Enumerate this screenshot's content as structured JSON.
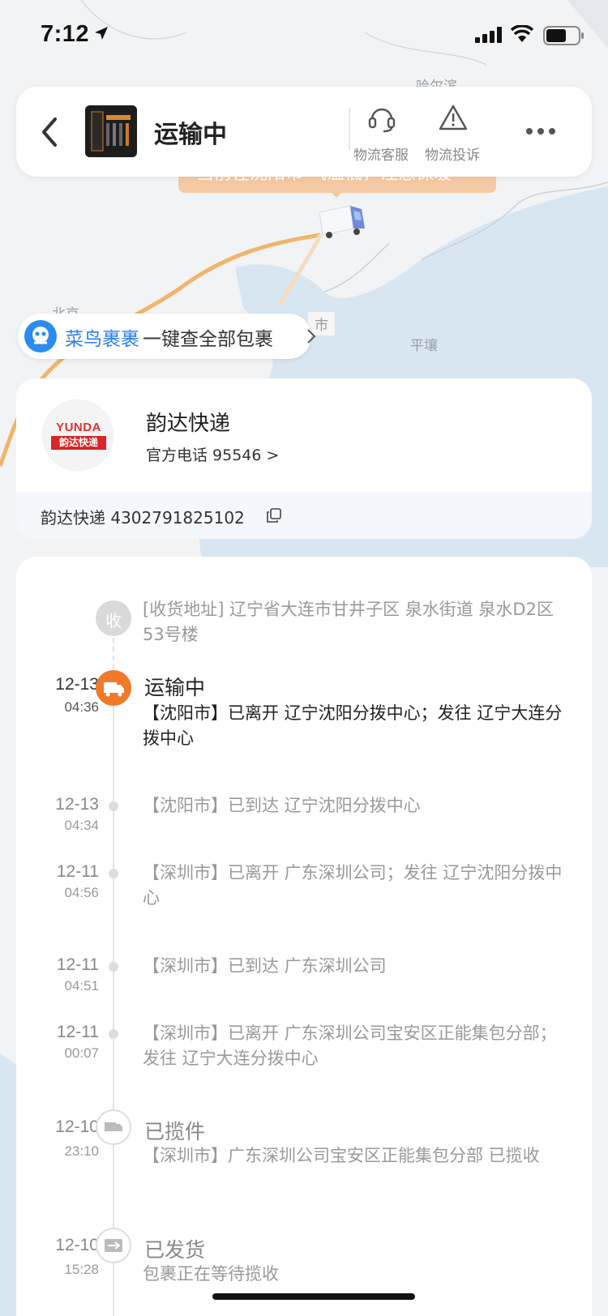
{
  "status_bar": {
    "time": "7:12"
  },
  "map": {
    "labels": [
      "哈尔滨",
      "北京",
      "平壤",
      "市"
    ]
  },
  "header": {
    "title": "运输中",
    "customer_service": "物流客服",
    "complaint": "物流投诉"
  },
  "toast": {
    "text": "当前在沈阳市 气温低，注意保暖"
  },
  "cainiao": {
    "brand": "菜鸟裹裹",
    "text": "一键查全部包裹"
  },
  "courier": {
    "logo_en": "YUNDA",
    "logo_cn": "韵达快递",
    "name": "韵达快递",
    "phone": "官方电话 95546 >",
    "tracking": "韵达快递 4302791825102"
  },
  "timeline": [
    {
      "date": "",
      "time": "",
      "status": "",
      "icon": "receive-icon",
      "badge_text": "收",
      "desc": "[收货地址] 辽宁省大连市甘井子区 泉水街道 泉水D2区53号楼"
    },
    {
      "date": "12-13",
      "time": "04:36",
      "status": "运输中",
      "icon": "truck-icon",
      "active": true,
      "desc": "【沈阳市】已离开 辽宁沈阳分拨中心；发往 辽宁大连分拨中心"
    },
    {
      "date": "12-13",
      "time": "04:34",
      "status": "",
      "desc": "【沈阳市】已到达 辽宁沈阳分拨中心"
    },
    {
      "date": "12-11",
      "time": "04:56",
      "status": "",
      "desc": "【深圳市】已离开 广东深圳公司；发往 辽宁沈阳分拨中心"
    },
    {
      "date": "12-11",
      "time": "04:51",
      "status": "",
      "desc": "【深圳市】已到达 广东深圳公司"
    },
    {
      "date": "12-11",
      "time": "00:07",
      "status": "",
      "desc": "【深圳市】已离开 广东深圳公司宝安区正能集包分部；发往 辽宁大连分拨中心"
    },
    {
      "date": "12-10",
      "time": "23:10",
      "status": "已揽件",
      "icon": "pickup-icon",
      "desc": "【深圳市】广东深圳公司宝安区正能集包分部 已揽收"
    },
    {
      "date": "12-10",
      "time": "15:28",
      "status": "已发货",
      "icon": "shipped-icon",
      "desc": "包裹正在等待揽收"
    }
  ],
  "colors": {
    "accent": "#f07a2a",
    "brand_blue": "#2b7ff0"
  }
}
